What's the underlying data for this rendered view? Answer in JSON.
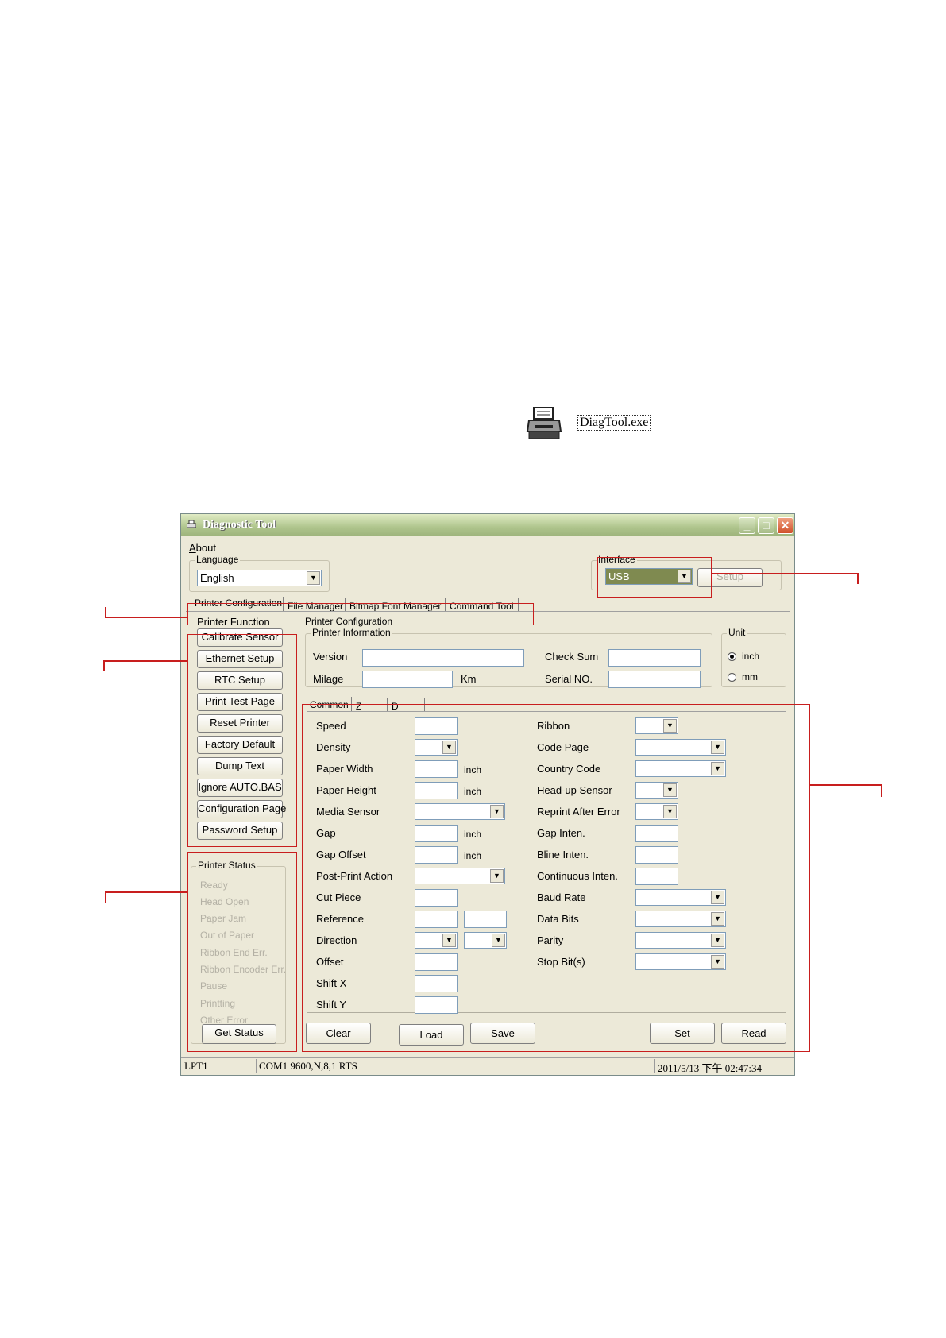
{
  "desktop": {
    "file_name": "DiagTool.exe"
  },
  "window": {
    "title": "Diagnostic Tool",
    "menu_about_first": "A",
    "menu_about_rest": "bout"
  },
  "language": {
    "label": "Language",
    "value": "English"
  },
  "interface": {
    "label": "Interface",
    "value": "USB",
    "setup_label": "Setup"
  },
  "main_tabs": [
    "Printer Configuration",
    "File Manager",
    "Bitmap Font Manager",
    "Command Tool"
  ],
  "printer_function": {
    "label": "Printer Function",
    "buttons": [
      "Calibrate Sensor",
      "Ethernet Setup",
      "RTC Setup",
      "Print Test Page",
      "Reset Printer",
      "Factory Default",
      "Dump Text",
      "Ignore AUTO.BAS",
      "Configuration Page",
      "Password Setup"
    ]
  },
  "printer_status": {
    "label": "Printer Status",
    "items": [
      "Ready",
      "Head Open",
      "Paper Jam",
      "Out of Paper",
      "Ribbon End Err.",
      "Ribbon Encoder Err.",
      "Pause",
      "Printting",
      "Other Error"
    ],
    "get_status_label": "Get Status"
  },
  "printer_configuration": {
    "label": "Printer Configuration",
    "info_label": "Printer Information",
    "version_label": "Version",
    "checksum_label": "Check Sum",
    "milage_label": "Milage",
    "km_unit": "Km",
    "serial_label": "Serial NO.",
    "unit_label": "Unit",
    "unit_inch": "inch",
    "unit_mm": "mm",
    "unit_selected": "inch"
  },
  "sub_tabs": [
    "Common",
    "Z",
    "D"
  ],
  "common_left": [
    {
      "label": "Speed"
    },
    {
      "label": "Density"
    },
    {
      "label": "Paper Width",
      "unit": "inch"
    },
    {
      "label": "Paper Height",
      "unit": "inch"
    },
    {
      "label": "Media Sensor"
    },
    {
      "label": "Gap",
      "unit": "inch"
    },
    {
      "label": "Gap Offset",
      "unit": "inch"
    },
    {
      "label": "Post-Print Action"
    },
    {
      "label": "Cut Piece"
    },
    {
      "label": "Reference"
    },
    {
      "label": "Direction"
    },
    {
      "label": "Offset"
    },
    {
      "label": "Shift X"
    },
    {
      "label": "Shift Y"
    }
  ],
  "common_right": [
    {
      "label": "Ribbon"
    },
    {
      "label": "Code Page"
    },
    {
      "label": "Country Code"
    },
    {
      "label": "Head-up Sensor"
    },
    {
      "label": "Reprint After Error"
    },
    {
      "label": "Gap Inten."
    },
    {
      "label": "Bline Inten."
    },
    {
      "label": "Continuous Inten."
    },
    {
      "label": "Baud Rate"
    },
    {
      "label": "Data Bits"
    },
    {
      "label": "Parity"
    },
    {
      "label": "Stop Bit(s)"
    }
  ],
  "action_buttons": {
    "clear": "Clear",
    "load": "Load",
    "save": "Save",
    "set": "Set",
    "read": "Read"
  },
  "status_bar": {
    "port": "LPT1",
    "com": "COM1 9600,N,8,1 RTS",
    "middle": "",
    "datetime": "2011/5/13 下午 02:47:34"
  }
}
